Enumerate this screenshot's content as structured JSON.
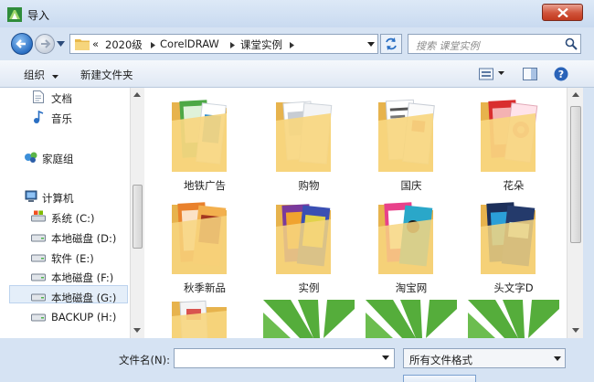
{
  "window": {
    "title": "导入"
  },
  "nav": {
    "path": [
      "«",
      "2020级",
      "CorelDRAW",
      "课堂实例"
    ],
    "search_placeholder": "搜索 课堂实例"
  },
  "toolbar": {
    "organize": "组织",
    "new_folder": "新建文件夹"
  },
  "sidebar": {
    "items": [
      {
        "label": "文档",
        "icon": "document-icon"
      },
      {
        "label": "音乐",
        "icon": "music-icon"
      },
      {
        "label": "家庭组",
        "icon": "homegroup-icon"
      },
      {
        "label": "计算机",
        "icon": "computer-icon"
      },
      {
        "label": "系统 (C:)",
        "icon": "system-drive-icon"
      },
      {
        "label": "本地磁盘 (D:)",
        "icon": "drive-icon"
      },
      {
        "label": "软件 (E:)",
        "icon": "drive-icon"
      },
      {
        "label": "本地磁盘 (F:)",
        "icon": "drive-icon"
      },
      {
        "label": "本地磁盘 (G:)",
        "icon": "drive-icon",
        "selected": true
      },
      {
        "label": "BACKUP (H:)",
        "icon": "drive-icon"
      }
    ]
  },
  "folders": [
    {
      "name": "地铁广告"
    },
    {
      "name": "购物"
    },
    {
      "name": "国庆"
    },
    {
      "name": "花朵"
    },
    {
      "name": "秋季新品"
    },
    {
      "name": "实例"
    },
    {
      "name": "淘宝网"
    },
    {
      "name": "头文字D"
    },
    {
      "name": ""
    },
    {
      "name": ""
    },
    {
      "name": ""
    },
    {
      "name": ""
    }
  ],
  "footer": {
    "file_name_label": "文件名(N):",
    "file_name_value": "",
    "file_type": "所有文件格式"
  },
  "colors": {
    "folder": "#f5d27a",
    "chrome": "#d6e3f3",
    "close": "#c7412a",
    "accent_green": "#55ad3b"
  }
}
